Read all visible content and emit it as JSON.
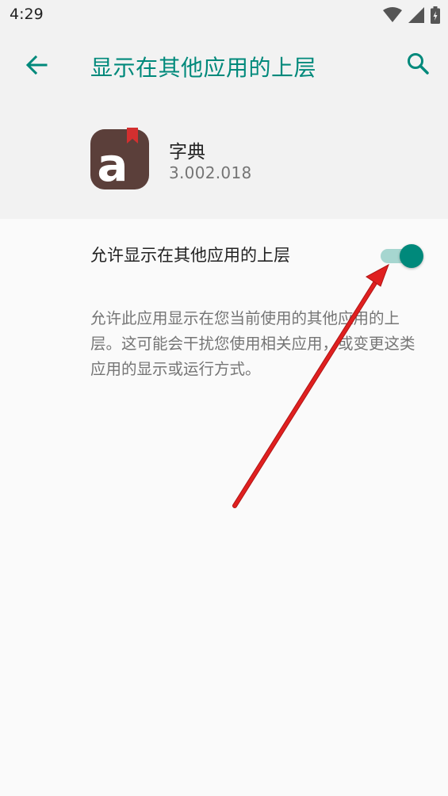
{
  "status_bar": {
    "time": "4:29",
    "icons": [
      "wifi-icon",
      "cellular-signal-icon",
      "battery-icon"
    ]
  },
  "header": {
    "title": "显示在其他应用的上层",
    "back_icon": "arrow-back-icon",
    "search_icon": "search-icon"
  },
  "app": {
    "name": "字典",
    "version": "3.002.018",
    "icon": "app-icon",
    "icon_letter": "a"
  },
  "setting": {
    "label": "允许显示在其他应用的上层",
    "enabled": true
  },
  "description": "允许此应用显示在您当前使用的其他应用的上层。这可能会干扰您使用相关应用，或变更这类应用的显示或运行方式。",
  "colors": {
    "accent": "#00897b",
    "switch_track": "#a6d6d0",
    "app_icon_bg": "#5b3f3a",
    "bookmark": "#d32f2f",
    "annotation_arrow": "#e02020",
    "header_bg": "#f2f2f2",
    "body_bg": "#fafafa"
  }
}
